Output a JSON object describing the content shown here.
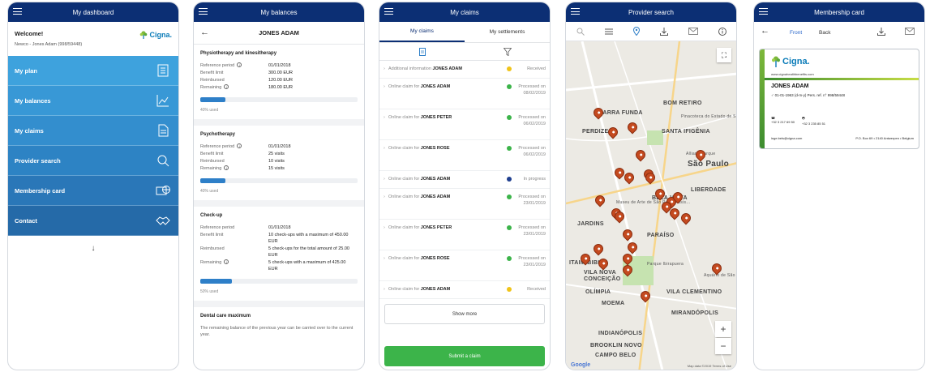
{
  "dashboard": {
    "title": "My dashboard",
    "welcome": "Welcome!",
    "user_line": "Newco - Jones Adam (998/59448)",
    "logo_text": "Cigna.",
    "items": [
      {
        "label": "My plan",
        "icon": "document-list-icon",
        "color": "#3ea2dd"
      },
      {
        "label": "My balances",
        "icon": "chart-line-icon",
        "color": "#3898d6"
      },
      {
        "label": "My claims",
        "icon": "document-icon",
        "color": "#338ece"
      },
      {
        "label": "Provider search",
        "icon": "search-icon",
        "color": "#2d83c4"
      },
      {
        "label": "Membership card",
        "icon": "card-globe-icon",
        "color": "#2a77b8"
      },
      {
        "label": "Contact",
        "icon": "handshake-icon",
        "color": "#256aa8"
      }
    ],
    "scroll_hint": "↓"
  },
  "balances": {
    "title": "My balances",
    "person": "JONES ADAM",
    "sections": [
      {
        "title": "Physiotherapy and kinesitherapy",
        "rows": [
          {
            "k": "Reference period",
            "v": "01/01/2018",
            "info": true
          },
          {
            "k": "Benefit limit",
            "v": "300.00 EUR",
            "info": false
          },
          {
            "k": "Reimbursed",
            "v": "120.00 EUR",
            "info": false
          },
          {
            "k": "Remaining",
            "v": "180.00 EUR",
            "info": true
          }
        ],
        "progress": 0.4,
        "used_label": "40% used"
      },
      {
        "title": "Psychotherapy",
        "rows": [
          {
            "k": "Reference period",
            "v": "01/01/2018",
            "info": true
          },
          {
            "k": "Benefit limit",
            "v": "25 visits",
            "info": false
          },
          {
            "k": "Reimbursed",
            "v": "10 visits",
            "info": false
          },
          {
            "k": "Remaining",
            "v": "15 visits",
            "info": true
          }
        ],
        "progress": 0.4,
        "used_label": "40% used"
      },
      {
        "title": "Check-up",
        "rows": [
          {
            "k": "Reference period",
            "v": "01/01/2018",
            "info": false
          },
          {
            "k": "Benefit limit",
            "v": "10 check-ups with a maximum of 450.00 EUR",
            "info": false
          },
          {
            "k": "Reimbursed",
            "v": "5 check-ups for the total amount of 25.00 EUR",
            "info": false
          },
          {
            "k": "Remaining",
            "v": "5 check-ups with a maximum of 425.00 EUR",
            "info": true
          }
        ],
        "progress": 0.5,
        "used_label": "50% used"
      }
    ],
    "dental_title": "Dental care maximum",
    "dental_note": "The remaining balance of the previous year can be carried over to the current year."
  },
  "claims": {
    "title": "My claims",
    "tabs": [
      "My claims",
      "My settlements"
    ],
    "items": [
      {
        "prefix": "Additional information",
        "name": "JONES ADAM",
        "status_color": "#f0c419",
        "status": "Received"
      },
      {
        "prefix": "Online claim for",
        "name": "JONES ADAM",
        "status_color": "#3cb44a",
        "status": "Processed on 08/02/2019"
      },
      {
        "prefix": "Online claim for",
        "name": "JONES PETER",
        "status_color": "#3cb44a",
        "status": "Processed on 06/02/2019"
      },
      {
        "prefix": "Online claim for",
        "name": "JONES ROSE",
        "status_color": "#3cb44a",
        "status": "Processed on 06/02/2019"
      },
      {
        "prefix": "Online claim for",
        "name": "JONES ADAM",
        "status_color": "#1f3f8f",
        "status": "In progress"
      },
      {
        "prefix": "Online claim for",
        "name": "JONES ADAM",
        "status_color": "#3cb44a",
        "status": "Processed on 23/01/2019"
      },
      {
        "prefix": "Online claim for",
        "name": "JONES PETER",
        "status_color": "#3cb44a",
        "status": "Processed on 23/01/2019"
      },
      {
        "prefix": "Online claim for",
        "name": "JONES ROSE",
        "status_color": "#3cb44a",
        "status": "Processed on 23/01/2019"
      },
      {
        "prefix": "Online claim for",
        "name": "JONES ADAM",
        "status_color": "#f0c419",
        "status": "Received"
      }
    ],
    "show_more": "Show more",
    "submit": "Submit a claim"
  },
  "provider": {
    "title": "Provider search",
    "map_labels": [
      {
        "t": "BARRA FUNDA",
        "cls": ""
      },
      {
        "t": "BOM RETIRO",
        "cls": ""
      },
      {
        "t": "PERDIZES",
        "cls": ""
      },
      {
        "t": "SANTA IFIGÊNIA",
        "cls": ""
      },
      {
        "t": "BELA VISTA",
        "cls": ""
      },
      {
        "t": "São Paulo",
        "cls": "big"
      },
      {
        "t": "LIBERDADE",
        "cls": ""
      },
      {
        "t": "JARDINS",
        "cls": ""
      },
      {
        "t": "PARAÍSO",
        "cls": ""
      },
      {
        "t": "ITAIM BIBI",
        "cls": ""
      },
      {
        "t": "VILA NOVA CONCEIÇÃO",
        "cls": ""
      },
      {
        "t": "OLÍMPIA",
        "cls": ""
      },
      {
        "t": "MOEMA",
        "cls": ""
      },
      {
        "t": "VILA CLEMENTINO",
        "cls": ""
      },
      {
        "t": "MIRANDÓPOLIS",
        "cls": ""
      },
      {
        "t": "INDIANÓPOLIS",
        "cls": ""
      },
      {
        "t": "BROOKLIN NOVO",
        "cls": ""
      },
      {
        "t": "CAMPO BELO",
        "cls": ""
      },
      {
        "t": "Museu de Arte de São Paulo Assis...",
        "cls": "small"
      },
      {
        "t": "Parque Ibirapuera",
        "cls": "small"
      },
      {
        "t": "Aquário de São Paulo",
        "cls": "small"
      },
      {
        "t": "Pinacoteca do Estado de São Paulo",
        "cls": "small"
      },
      {
        "t": "Allianz Parque",
        "cls": "small"
      }
    ],
    "pin_count_label": "",
    "google": "Google",
    "copyright": "Map data ©2019 Terms of Use"
  },
  "membership": {
    "title": "Membership card",
    "front": "Front",
    "back": "Back",
    "logo": "Cigna.",
    "site": "www.cignahealthbenefits.com",
    "holder": "JONES ADAM",
    "line1": "01-01-1963 (d-m-y) Pers. ref. n° 998/59448",
    "phone1": "+32 3 217 69 50",
    "phone2": "+32 3 235 85 51",
    "email": "inge.bels@cigna.com",
    "address": "P.O. Box 69 • 2140 Antwerpen • Belgium"
  }
}
